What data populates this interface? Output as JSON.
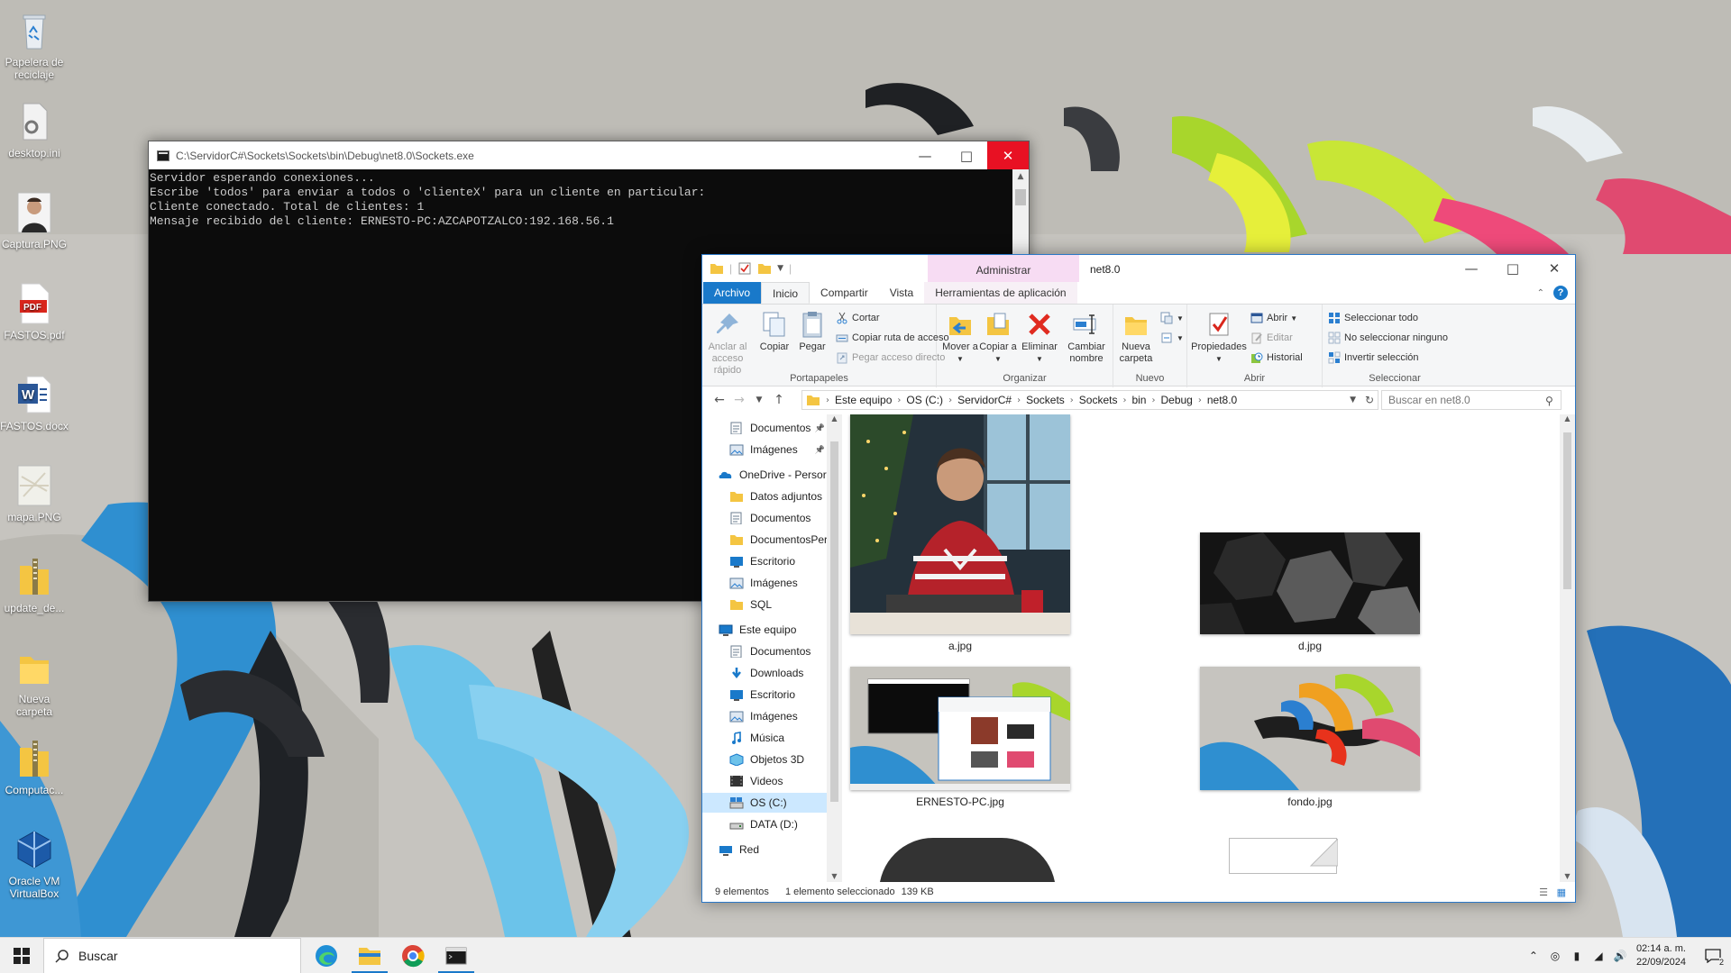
{
  "desktop": {
    "icons": [
      {
        "label": "Papelera de reciclaje",
        "icon": "recycle-bin-icon"
      },
      {
        "label": "desktop.ini",
        "icon": "settings-file-icon"
      },
      {
        "label": "Captura.PNG",
        "icon": "image-file-icon"
      },
      {
        "label": "FASTOS.pdf",
        "icon": "pdf-file-icon"
      },
      {
        "label": "FASTOS.docx",
        "icon": "word-file-icon"
      },
      {
        "label": "mapa.PNG",
        "icon": "image-file-icon"
      },
      {
        "label": "update_de...",
        "icon": "zip-folder-icon"
      },
      {
        "label": "Nueva carpeta",
        "icon": "folder-icon"
      },
      {
        "label": "Computac...",
        "icon": "zip-folder-icon"
      },
      {
        "label": "Oracle VM VirtualBox",
        "icon": "virtualbox-icon"
      }
    ]
  },
  "console": {
    "title": "C:\\ServidorC#\\Sockets\\Sockets\\bin\\Debug\\net8.0\\Sockets.exe",
    "lines": [
      "Servidor esperando conexiones...",
      "Escribe 'todos' para enviar a todos o 'clienteX' para un cliente en particular:",
      "Cliente conectado. Total de clientes: 1",
      "Mensaje recibido del cliente: ERNESTO-PC:AZCAPOTZALCO:192.168.56.1"
    ]
  },
  "explorer": {
    "title": "net8.0",
    "context_tab": "Administrar",
    "tabs": [
      "Archivo",
      "Inicio",
      "Compartir",
      "Vista",
      "Herramientas de aplicación"
    ],
    "ribbon": {
      "portapapeles": {
        "name": "Portapapeles",
        "pin": "Anclar al acceso rápido",
        "copy": "Copiar",
        "paste": "Pegar",
        "cut": "Cortar",
        "copy_path": "Copiar ruta de acceso",
        "paste_shortcut": "Pegar acceso directo"
      },
      "organizar": {
        "name": "Organizar",
        "move": "Mover a",
        "copy_to": "Copiar a",
        "delete": "Eliminar",
        "rename": "Cambiar nombre"
      },
      "nuevo": {
        "name": "Nuevo",
        "new_folder": "Nueva carpeta"
      },
      "abrir": {
        "name": "Abrir",
        "properties": "Propiedades",
        "open": "Abrir",
        "edit": "Editar",
        "history": "Historial"
      },
      "seleccionar": {
        "name": "Seleccionar",
        "select_all": "Seleccionar todo",
        "select_none": "No seleccionar ninguno",
        "invert": "Invertir selección"
      }
    },
    "address": [
      "Este equipo",
      "OS (C:)",
      "ServidorC#",
      "Sockets",
      "Sockets",
      "bin",
      "Debug",
      "net8.0"
    ],
    "search_placeholder": "Buscar en net8.0",
    "nav": [
      {
        "label": "Documentos",
        "icon": "documents-icon",
        "pinned": true
      },
      {
        "label": "Imágenes",
        "icon": "pictures-icon",
        "pinned": true
      },
      {
        "label": "OneDrive - Persor",
        "icon": "onedrive-icon"
      },
      {
        "label": "Datos adjuntos",
        "icon": "folder-icon"
      },
      {
        "label": "Documentos",
        "icon": "documents-icon"
      },
      {
        "label": "DocumentosPer",
        "icon": "folder-icon"
      },
      {
        "label": "Escritorio",
        "icon": "desktop-icon"
      },
      {
        "label": "Imágenes",
        "icon": "pictures-icon"
      },
      {
        "label": "SQL",
        "icon": "folder-icon"
      },
      {
        "label": "Este equipo",
        "icon": "this-pc-icon"
      },
      {
        "label": "Documentos",
        "icon": "documents-icon"
      },
      {
        "label": "Downloads",
        "icon": "downloads-icon"
      },
      {
        "label": "Escritorio",
        "icon": "desktop-icon"
      },
      {
        "label": "Imágenes",
        "icon": "pictures-icon"
      },
      {
        "label": "Música",
        "icon": "music-icon"
      },
      {
        "label": "Objetos 3D",
        "icon": "3d-objects-icon"
      },
      {
        "label": "Videos",
        "icon": "videos-icon"
      },
      {
        "label": "OS (C:)",
        "icon": "drive-c-icon",
        "selected": true
      },
      {
        "label": "DATA (D:)",
        "icon": "drive-d-icon"
      },
      {
        "label": "Red",
        "icon": "network-icon"
      }
    ],
    "files": [
      {
        "name": "a.jpg"
      },
      {
        "name": "d.jpg"
      },
      {
        "name": "ERNESTO-PC.jpg"
      },
      {
        "name": "fondo.jpg"
      }
    ],
    "status": {
      "count": "9 elementos",
      "selection": "1 elemento seleccionado",
      "size": "139 KB"
    }
  },
  "taskbar": {
    "search_placeholder": "Buscar",
    "apps": [
      "edge-icon",
      "file-explorer-icon",
      "chrome-icon",
      "console-app-icon"
    ],
    "time": "02:14 a. m.",
    "date": "22/09/2024",
    "notification_count": "2"
  }
}
